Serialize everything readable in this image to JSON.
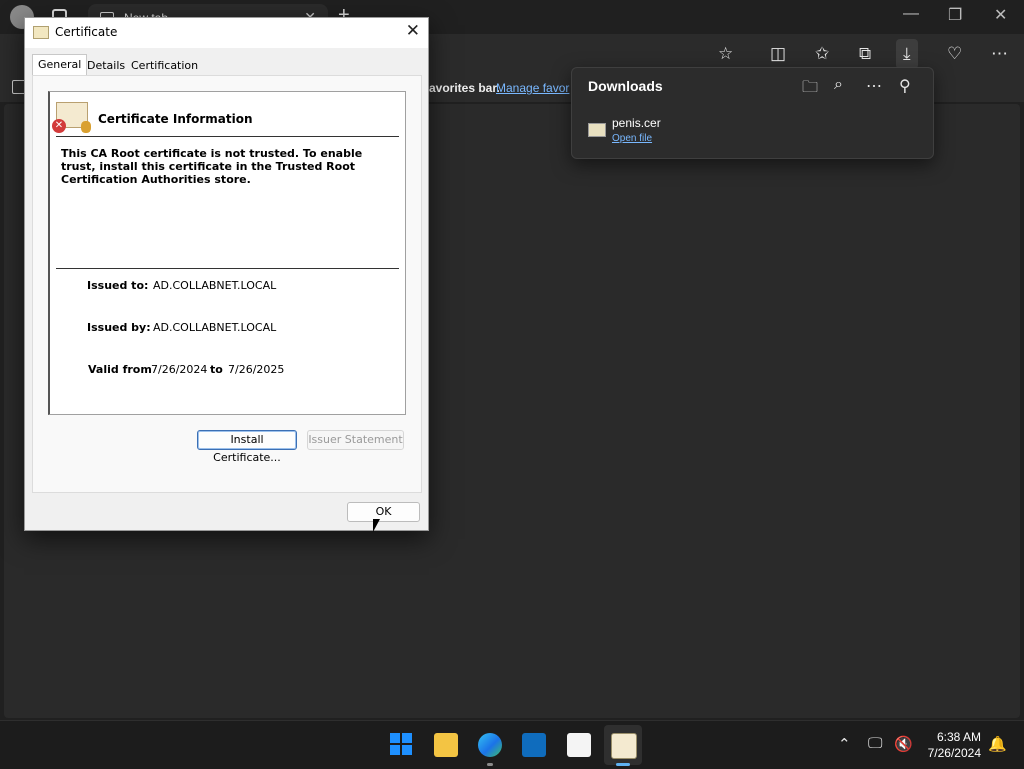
{
  "browser": {
    "tab_title": "New tab",
    "favorites_bar_text": "favorites bar.",
    "favorites_bar_link": "Manage favor"
  },
  "downloads": {
    "title": "Downloads",
    "item": {
      "filename": "penis.cer",
      "action": "Open file"
    }
  },
  "dialog": {
    "title": "Certificate",
    "tabs": [
      "General",
      "Details",
      "Certification Path"
    ],
    "selected_tab": "General",
    "heading": "Certificate Information",
    "warning": "This CA Root certificate is not trusted. To enable trust, install this certificate in the Trusted Root Certification Authorities store.",
    "issued_to_label": "Issued to:",
    "issued_to": "AD.COLLABNET.LOCAL",
    "issued_by_label": "Issued by:",
    "issued_by": "AD.COLLABNET.LOCAL",
    "valid_from_label": "Valid from",
    "valid_from": "7/26/2024",
    "valid_to_label": "to",
    "valid_to": "7/26/2025",
    "install_button": "Install Certificate...",
    "issuer_statement_button": "Issuer Statement",
    "ok_button": "OK"
  },
  "taskbar": {
    "time": "6:38 AM",
    "date": "7/26/2024"
  },
  "colors": {
    "accent": "#5fb2f2",
    "link": "#79b8ff",
    "error": "#d23a3a"
  }
}
